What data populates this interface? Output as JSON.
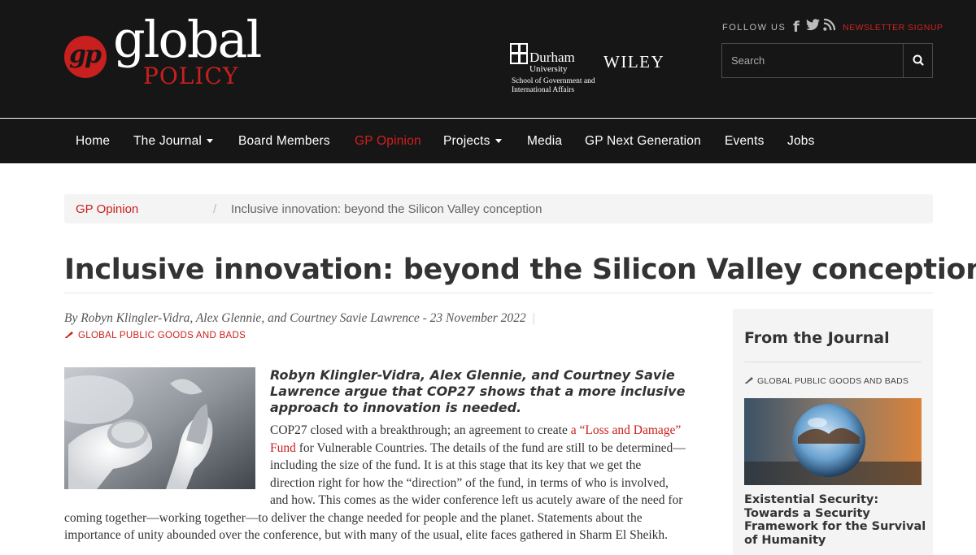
{
  "brand": {
    "logo_mark": "gp",
    "logo_word1": "global",
    "logo_word2": "POLICY",
    "partner1_name": "Durham",
    "partner1_sub": "University",
    "partner1_dept": "School of Government and International Affairs",
    "partner2_name": "WILEY"
  },
  "header": {
    "follow_label": "FOLLOW US",
    "newsletter_label": "NEWSLETTER SIGNUP",
    "search_placeholder": "Search"
  },
  "nav": {
    "items": [
      {
        "label": "Home"
      },
      {
        "label": "The Journal",
        "dropdown": true
      },
      {
        "label": "Board Members"
      },
      {
        "label": "GP Opinion",
        "active": true
      },
      {
        "label": "Projects",
        "dropdown": true
      },
      {
        "label": "Media"
      },
      {
        "label": "GP Next Generation"
      },
      {
        "label": "Events"
      },
      {
        "label": "Jobs"
      }
    ]
  },
  "breadcrumb": {
    "parent": "GP Opinion",
    "separator": "/",
    "current": "Inclusive innovation: beyond the Silicon Valley conception"
  },
  "article": {
    "title": "Inclusive innovation: beyond the Silicon Valley conception",
    "byline": "By Robyn Klingler-Vidra, Alex Glennie, and Courtney Savie Lawrence - 23 November 2022",
    "byline_sep": "|",
    "tag": "GLOBAL PUBLIC GOODS AND BADS",
    "lead": "Robyn Klingler-Vidra, Alex Glennie, and Courtney Savie Lawrence argue that COP27 shows that a more inclusive approach to innovation is needed.",
    "body_lines": [
      {
        "pre": "COP27 closed with a breakthrough; an agreement to create ",
        "link": "a “Loss and Damage”",
        "post": ""
      },
      {
        "pre": "",
        "link": "Fund",
        "post": " for Vulnerable Countries. The details of the fund are still to be determined—"
      },
      {
        "pre": "including the size of the fund. It is at this stage that its key that we get the",
        "link": "",
        "post": ""
      },
      {
        "pre": "direction right for how the “direction” of the fund, in terms of who is involved,",
        "link": "",
        "post": ""
      },
      {
        "pre": "and how. This comes as the wider conference left us acutely aware of the need for",
        "link": "",
        "post": ""
      },
      {
        "pre": "coming together—working together—to deliver the change needed for people and the planet. Statements about the",
        "link": "",
        "post": ""
      },
      {
        "pre": "importance of unity abounded over the conference, but with many of the usual, elite faces gathered in Sharm El Sheikh.",
        "link": "",
        "post": ""
      }
    ]
  },
  "sidebar": {
    "heading": "From the Journal",
    "tag": "GLOBAL PUBLIC GOODS AND BADS",
    "article_title": "Existential Security: Towards a Security Framework for the Survival of Humanity"
  },
  "colors": {
    "accent": "#c8201e",
    "header_bg": "#161616",
    "panel_bg": "#f4f4f4"
  },
  "icons": [
    "facebook-icon",
    "twitter-icon",
    "rss-icon",
    "search-icon",
    "caret-down-icon",
    "tag-icon"
  ]
}
